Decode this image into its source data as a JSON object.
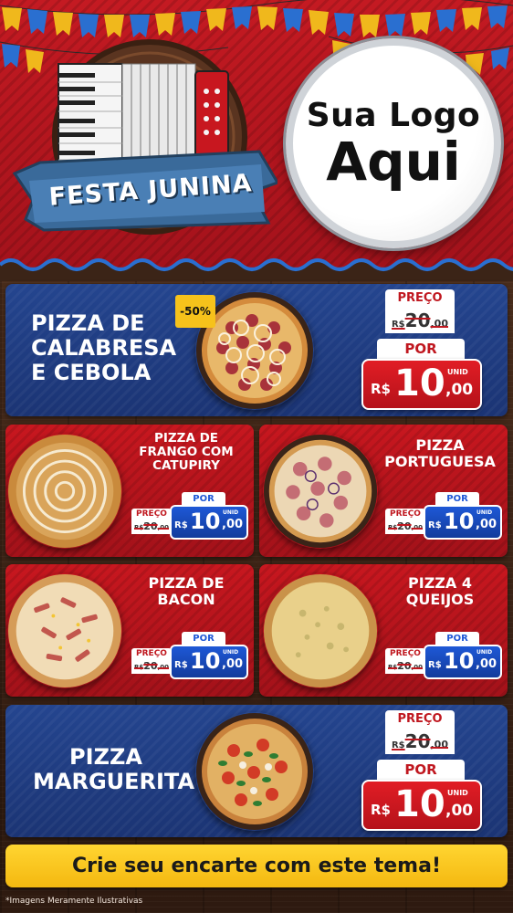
{
  "header": {
    "emblem_text": "FESTA JUNINA",
    "logo_line1": "Sua Logo",
    "logo_line2": "Aqui"
  },
  "colors": {
    "header_red": "#c41a22",
    "card_blue": "#24458f",
    "card_red": "#c8171f",
    "price_red": "#e11d25",
    "price_blue": "#1e58d6",
    "cta_yellow": "#ffd531"
  },
  "products": [
    {
      "name_lines": [
        "PIZZA DE",
        "CALABRESA",
        "E CEBOLA"
      ],
      "badge": "-50%",
      "preco_label": "PREÇO",
      "old_currency": "R$",
      "old_value": "20",
      "old_cents": ",00",
      "por_label": "POR",
      "new_currency": "R$",
      "new_value": "10",
      "new_cents": ",00",
      "unit": "UNID"
    },
    {
      "name_lines": [
        "PIZZA DE",
        "FRANGO COM",
        "CATUPIRY"
      ],
      "preco_label": "PREÇO",
      "old_currency": "R$",
      "old_value": "20",
      "old_cents": ",00",
      "por_label": "POR",
      "new_currency": "R$",
      "new_value": "10",
      "new_cents": ",00",
      "unit": "UNID"
    },
    {
      "name_lines": [
        "PIZZA",
        "PORTUGUESA"
      ],
      "preco_label": "PREÇO",
      "old_currency": "R$",
      "old_value": "20",
      "old_cents": ",00",
      "por_label": "POR",
      "new_currency": "R$",
      "new_value": "10",
      "new_cents": ",00",
      "unit": "UNID"
    },
    {
      "name_lines": [
        "PIZZA DE",
        "BACON"
      ],
      "preco_label": "PREÇO",
      "old_currency": "R$",
      "old_value": "20",
      "old_cents": ",00",
      "por_label": "POR",
      "new_currency": "R$",
      "new_value": "10",
      "new_cents": ",00",
      "unit": "UNID"
    },
    {
      "name_lines": [
        "PIZZA 4",
        "QUEIJOS"
      ],
      "preco_label": "PREÇO",
      "old_currency": "R$",
      "old_value": "20",
      "old_cents": ",00",
      "por_label": "POR",
      "new_currency": "R$",
      "new_value": "10",
      "new_cents": ",00",
      "unit": "UNID"
    },
    {
      "name_lines": [
        "PIZZA",
        "MARGUERITA"
      ],
      "preco_label": "PREÇO",
      "old_currency": "R$",
      "old_value": "20",
      "old_cents": ",00",
      "por_label": "POR",
      "new_currency": "R$",
      "new_value": "10",
      "new_cents": ",00",
      "unit": "UNID"
    }
  ],
  "footer": {
    "cta": "Crie seu encarte com este tema!",
    "disclaimer": "*Imagens Meramente Ilustrativas"
  }
}
